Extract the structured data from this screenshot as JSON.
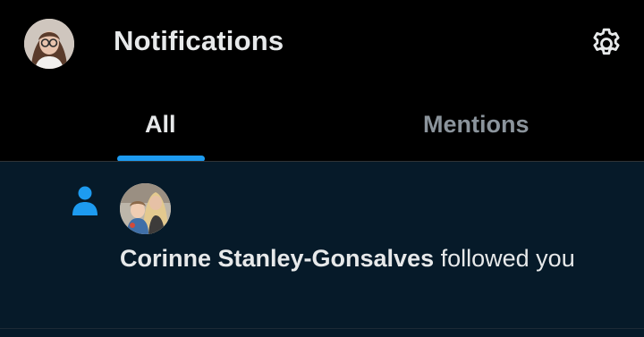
{
  "header": {
    "title": "Notifications",
    "avatar_icon": "profile-avatar",
    "settings_icon": "gear-icon"
  },
  "tabs": [
    {
      "label": "All",
      "selected": true
    },
    {
      "label": "Mentions",
      "selected": false
    }
  ],
  "notification": {
    "icon": "person-icon",
    "user_name": "Corinne Stanley-Gonsalves",
    "action_text": " followed you"
  },
  "colors": {
    "accent": "#1d9bf0",
    "background": "#000000",
    "unread_row": "#061a29",
    "text_primary": "#e7e9ea",
    "text_secondary": "#8b949c"
  }
}
